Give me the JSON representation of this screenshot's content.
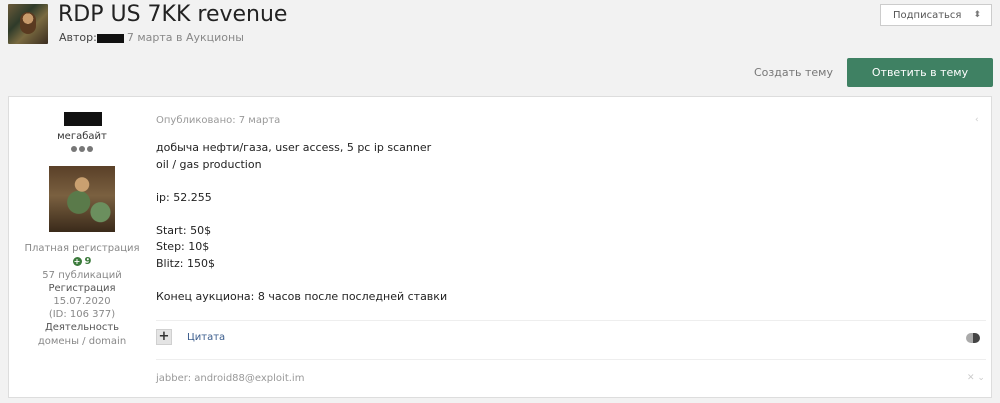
{
  "topic": {
    "title": "RDP US 7KK revenue",
    "author_label": "Автор:",
    "date_text": "7 марта в Аукционы"
  },
  "header": {
    "follow_label": "Подписаться",
    "follow_caret": "⬍",
    "start_topic_label": "Создать тему",
    "reply_label": "Ответить в тему"
  },
  "author": {
    "rank": "мегабайт",
    "group": "Платная регистрация",
    "reputation": "9",
    "posts": "57 публикаций",
    "registration_label": "Регистрация",
    "registration_date": "15.07.2020",
    "id_text": "(ID: 106 377)",
    "activity_label": "Деятельность",
    "activity_value": "домены / domain"
  },
  "post": {
    "published": "Опубликовано: 7 марта",
    "lines": [
      "добыча нефти/газа, user access, 5 pc ip scanner",
      "oil / gas production",
      "",
      "ip: 52.255",
      "",
      "Start: 50$",
      "Step: 10$",
      "Blitz: 150$",
      "",
      "Конец аукциона: 8 часов после последней ставки"
    ],
    "plus_label": "+",
    "quote_label": "Цитата",
    "signature": "jabber: android88@exploit.im",
    "share_icon_glyph": "‹",
    "sig_close_glyph": "✕ ⌄"
  },
  "colors": {
    "accent": "#3f8163",
    "link": "#3a5c8c",
    "reputation": "#3b7a3b"
  },
  "icons": {
    "share": "share-icon",
    "toggle": "toggle-icon",
    "close": "close-icon",
    "follow_caret": "sort-caret-icon"
  }
}
